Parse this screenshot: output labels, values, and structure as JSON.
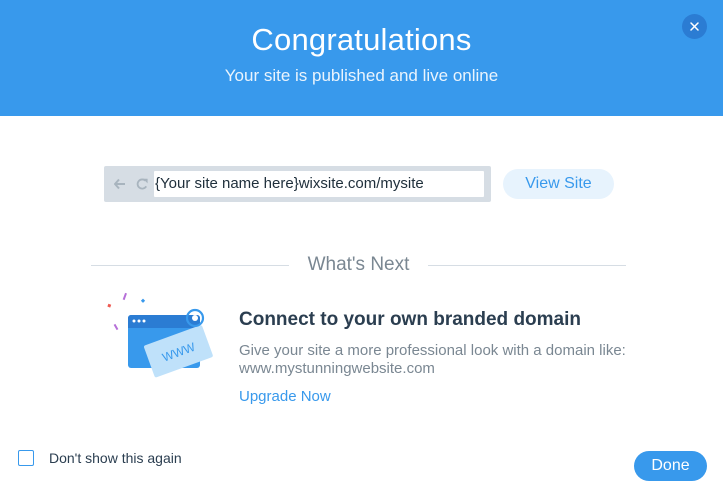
{
  "header": {
    "title": "Congratulations",
    "subtitle": "Your site is published and live online",
    "close_icon": "close-icon",
    "background_color": "#3899ec"
  },
  "browser_preview": {
    "nav_icons": [
      "back-arrow-icon",
      "refresh-icon"
    ],
    "url": "{Your site name here}wixsite.com/mysite"
  },
  "view_site_button": {
    "label": "View Site"
  },
  "whats_next": {
    "heading": "What's Next"
  },
  "promo": {
    "illustration_icon": "browser-www-illustration-icon",
    "illustration_text": "WWW",
    "title": "Connect to your own branded domain",
    "description": "Give your site a more professional look with a domain like: www.mystunningwebsite.com",
    "link_label": "Upgrade Now"
  },
  "footer": {
    "checkbox_label": "Don't show this again",
    "checkbox_checked": false,
    "done_label": "Done"
  },
  "colors": {
    "accent": "#3899ec",
    "text_dark": "#2b3e50",
    "text_muted": "#7a8792",
    "button_light": "#e7f3fd"
  }
}
